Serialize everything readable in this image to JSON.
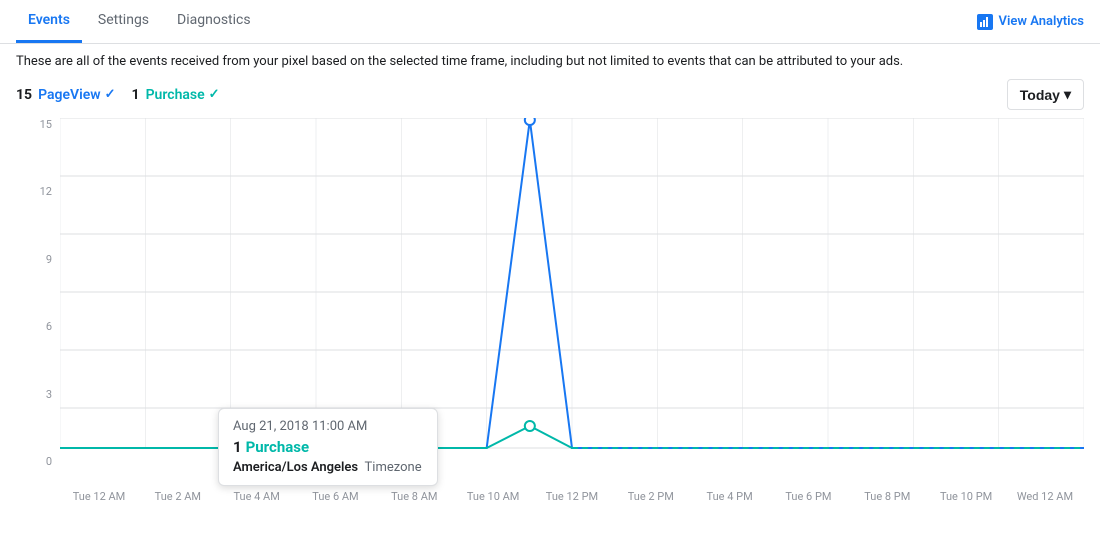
{
  "tabs": [
    {
      "label": "Events",
      "active": true
    },
    {
      "label": "Settings",
      "active": false
    },
    {
      "label": "Diagnostics",
      "active": false
    }
  ],
  "viewAnalytics": {
    "label": "View Analytics"
  },
  "description": "These are all of the events received from your pixel based on the selected time frame, including but not limited to events that can be attributed to your ads.",
  "legend": {
    "pageview": {
      "count": "15",
      "label": "PageView",
      "check": "✓"
    },
    "purchase": {
      "count": "1",
      "label": "Purchase",
      "check": "✓"
    }
  },
  "todayButton": "Today",
  "chart": {
    "yLabels": [
      "15",
      "12",
      "9",
      "6",
      "3",
      "0"
    ],
    "xLabels": [
      "Tue 12 AM",
      "Tue 2 AM",
      "Tue 4 AM",
      "Tue 6 AM",
      "Tue 8 AM",
      "Tue 10 AM",
      "Tue 12 PM",
      "Tue 2 PM",
      "Tue 4 PM",
      "Tue 6 PM",
      "Tue 8 PM",
      "Tue 10 PM",
      "Wed 12 AM"
    ]
  },
  "tooltip": {
    "time": "Aug 21, 2018 11:00 AM",
    "count": "1",
    "event": "Purchase",
    "timezoneLabel": "America/Los Angeles",
    "timezoneText": "Timezone"
  }
}
